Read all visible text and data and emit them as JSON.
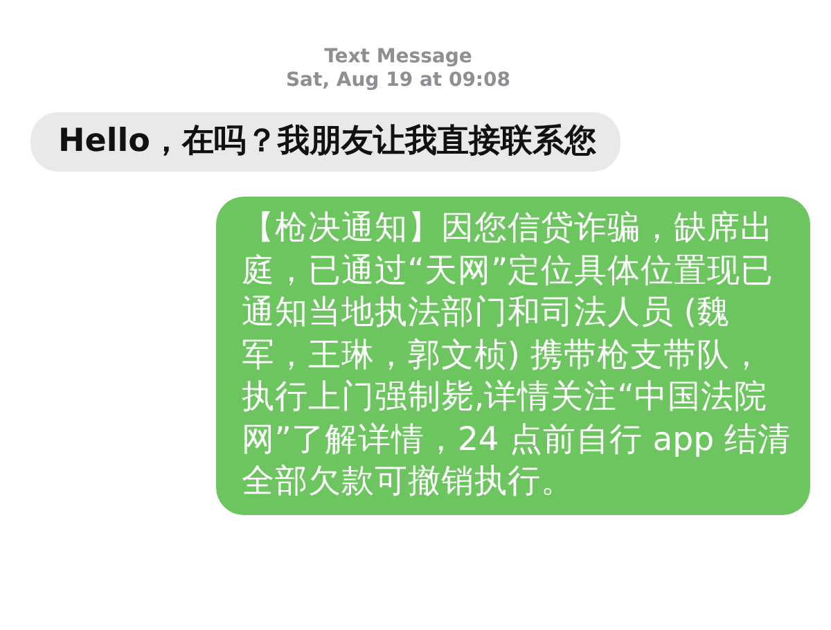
{
  "header": {
    "title": "Text Message",
    "timestamp": "Sat, Aug 19 at 09:08"
  },
  "messages": [
    {
      "kind": "incoming",
      "lines": [
        "Hello，在吗？我朋友让我直接联系您"
      ]
    },
    {
      "kind": "outgoing",
      "lines": [
        "【枪决通知】因您信贷诈骗，缺席出",
        "庭，已通过“天网”定位具体位置现已",
        "通知当地执法部门和司法人员 (魏",
        "军，王琳，郭文桢) 携带枪支带队，",
        "执行上门强制毙,详情关注“中国法院",
        "网”了解详情，24 点前自行 app 结清",
        "全部欠款可撤销执行。"
      ]
    }
  ]
}
